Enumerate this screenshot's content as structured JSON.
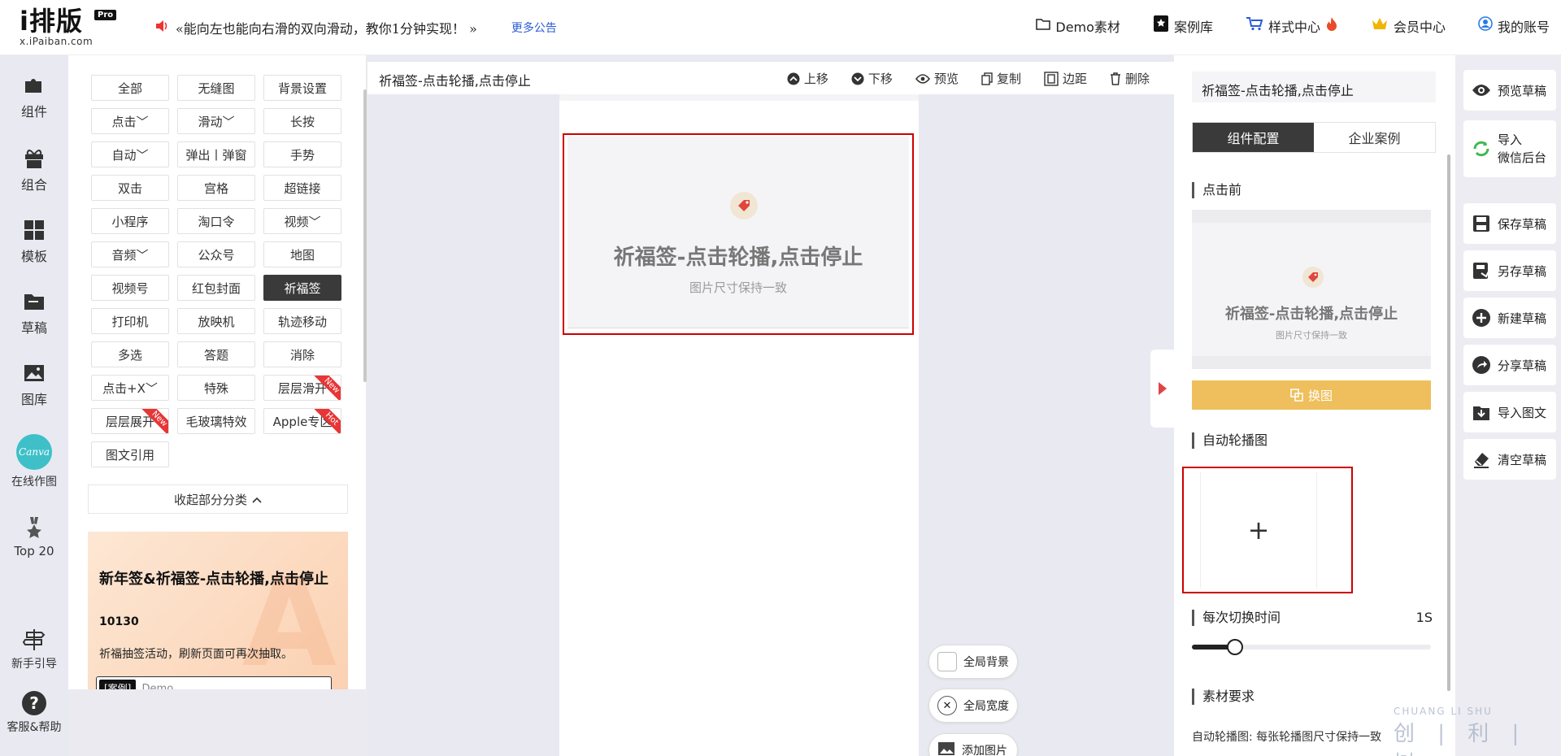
{
  "header": {
    "logo_main": "i排版",
    "logo_badge": "Pro",
    "logo_sub": "x.iPaiban.com",
    "notice": "«能向左也能向右滑的双向滑动，教你1分钟实现！ »",
    "more_notice": "更多公告",
    "nav": [
      {
        "icon": "folder-icon",
        "label": "Demo素材"
      },
      {
        "icon": "star-book-icon",
        "label": "案例库"
      },
      {
        "icon": "cart-icon",
        "label": "样式中心"
      },
      {
        "icon": "crown-icon",
        "label": "会员中心"
      },
      {
        "icon": "user-icon",
        "label": "我的账号"
      }
    ]
  },
  "leftnav": [
    {
      "label": "组件",
      "icon": "puzzle-icon"
    },
    {
      "label": "组合",
      "icon": "gift-icon"
    },
    {
      "label": "模板",
      "icon": "grid-icon"
    },
    {
      "label": "草稿",
      "icon": "folder-icon"
    },
    {
      "label": "图库",
      "icon": "image-icon"
    },
    {
      "label": "在线作图",
      "icon": "canva-icon",
      "badge": "Canva"
    },
    {
      "label": "Top 20",
      "icon": "medal-icon"
    },
    {
      "label": "新手引导",
      "icon": "signpost-icon"
    },
    {
      "label": "客服&帮助",
      "icon": "help-icon"
    }
  ],
  "components": [
    {
      "label": "全部"
    },
    {
      "label": "无缝图"
    },
    {
      "label": "背景设置"
    },
    {
      "label": "点击﹀"
    },
    {
      "label": "滑动﹀"
    },
    {
      "label": "长按"
    },
    {
      "label": "自动﹀"
    },
    {
      "label": "弹出丨弹窗"
    },
    {
      "label": "手势"
    },
    {
      "label": "双击"
    },
    {
      "label": "宫格"
    },
    {
      "label": "超链接"
    },
    {
      "label": "小程序"
    },
    {
      "label": "淘口令"
    },
    {
      "label": "视频﹀"
    },
    {
      "label": "音频﹀"
    },
    {
      "label": "公众号"
    },
    {
      "label": "地图"
    },
    {
      "label": "视频号"
    },
    {
      "label": "红包封面"
    },
    {
      "label": "祈福签",
      "active": true
    },
    {
      "label": "打印机"
    },
    {
      "label": "放映机"
    },
    {
      "label": "轨迹移动"
    },
    {
      "label": "多选"
    },
    {
      "label": "答题"
    },
    {
      "label": "消除"
    },
    {
      "label": "点击+X﹀"
    },
    {
      "label": "特殊"
    },
    {
      "label": "层层滑开",
      "ribbon": "New"
    },
    {
      "label": "层层展开",
      "ribbon": "New"
    },
    {
      "label": "毛玻璃特效"
    },
    {
      "label": "Apple专区",
      "ribbon": "Hot"
    },
    {
      "label": "图文引用"
    }
  ],
  "collapse_label": "收起部分分类",
  "promo": {
    "title": "新年签&祈福签-点击轮播,点击停止",
    "number": "10130",
    "desc": "祈福抽签活动，刷新页面可再次抽取。",
    "tag": "[案例]",
    "input_text": "Demo"
  },
  "toolbar": {
    "title": "祈福签-点击轮播,点击停止",
    "tools": [
      {
        "icon": "up-icon",
        "label": "上移"
      },
      {
        "icon": "down-icon",
        "label": "下移"
      },
      {
        "icon": "eye-icon",
        "label": "预览"
      },
      {
        "icon": "copy-icon",
        "label": "复制"
      },
      {
        "icon": "margin-icon",
        "label": "边距"
      },
      {
        "icon": "trash-icon",
        "label": "删除"
      }
    ]
  },
  "canvas_card": {
    "title": "祈福签-点击轮播,点击停止",
    "subtitle": "图片尺寸保持一致"
  },
  "float_buttons": [
    {
      "label": "全局背景"
    },
    {
      "label": "全局宽度"
    },
    {
      "label": "添加图片"
    }
  ],
  "config": {
    "title": "祈福签-点击轮播,点击停止",
    "tabs": [
      "组件配置",
      "企业案例"
    ],
    "section_before": "点击前",
    "preview_title": "祈福签-点击轮播,点击停止",
    "preview_sub": "图片尺寸保持一致",
    "swap_label": "换图",
    "section_auto": "自动轮播图",
    "upload_plus": "+",
    "section_interval": "每次切换时间",
    "interval_value": "1S",
    "interval_fraction": 0.18,
    "section_requirements": "素材要求",
    "req_label": "自动轮播图:",
    "req_text": "每张轮播图尺寸保持一致"
  },
  "actions": [
    {
      "label": "预览草稿",
      "icon": "eye-icon"
    },
    {
      "label": "导入\n微信后台",
      "icon": "wechat-sync-icon"
    },
    {
      "label": "保存草稿",
      "icon": "save-icon"
    },
    {
      "label": "另存草稿",
      "icon": "save-as-icon"
    },
    {
      "label": "新建草稿",
      "icon": "plus-circle-icon"
    },
    {
      "label": "分享草稿",
      "icon": "share-icon"
    },
    {
      "label": "导入图文",
      "icon": "import-icon"
    },
    {
      "label": "清空草稿",
      "icon": "eraser-icon"
    }
  ],
  "watermark": {
    "top": "CHUANG LI SHU",
    "bottom": "创 | 利 | 树"
  },
  "colors": {
    "accent_red": "#cc0000",
    "swap_gold": "#eebf5c",
    "active_dark": "#3a3a3a"
  }
}
